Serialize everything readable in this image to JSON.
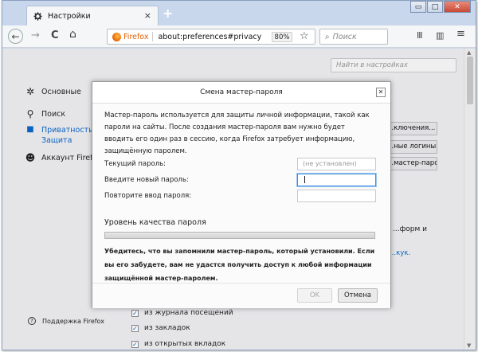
{
  "browser": {
    "tab_title": "Настройки",
    "tab_close": "×",
    "new_tab": "+",
    "window_controls": {
      "minimize": "▭",
      "maximize": "□",
      "close": "✕"
    },
    "back": "←",
    "forward": "→",
    "reload": "C",
    "home": "⌂",
    "identity_label": "Firefox",
    "url": "about:preferences#privacy",
    "zoom": "80%",
    "bookmark_star": "☆",
    "search_placeholder": "Поиск",
    "search_glyph": "⌕",
    "library": "Ⅲ",
    "sidebar": "▥",
    "menu": "≡"
  },
  "preferences": {
    "find_placeholder": "Найти в настройках",
    "sidebar": [
      {
        "label": "Основные",
        "icon": "gear-icon"
      },
      {
        "label": "Поиск",
        "icon": "search-icon"
      },
      {
        "label": "Приватность и",
        "label2": "Защита",
        "icon": "lock-icon"
      },
      {
        "label": "Аккаунт Firefox",
        "icon": "account-icon"
      }
    ],
    "support": "Поддержка Firefox",
    "bg_buttons": [
      "...ключения...",
      "...ные логины...",
      "...мастер-паро..."
    ],
    "bg_text_1": "...форм и",
    "bg_link": "...кук.",
    "checkbox_rows": [
      {
        "label": "из журнала посещений",
        "checked": "✓"
      },
      {
        "label": "из закладок",
        "checked": "✓"
      },
      {
        "label": "из открытых вкладок",
        "checked": "✓"
      }
    ]
  },
  "dialog": {
    "title": "Смена мастер-пароля",
    "close": "✕",
    "intro": "Мастер-пароль используется для защиты личной информации, такой как пароли на сайты. После создания мастер-пароля вам нужно будет вводить его один раз в сессию, когда Firefox затребует информацию, защищённую паролем.",
    "current_label": "Текущий пароль:",
    "current_value": "(не установлен)",
    "new_label": "Введите новый пароль:",
    "repeat_label": "Повторите ввод пароля:",
    "quality_title": "Уровень качества пароля",
    "quality_level": 0,
    "warning": "Убедитесь, что вы запомнили мастер-пароль, который установили. Если вы его забудете, вам не удастся получить доступ к любой информации защищённой мастер-паролем.",
    "ok": "OK",
    "cancel": "Отмена"
  },
  "colors": {
    "accent": "#0a64c8",
    "firefox_orange": "#e66000",
    "focus": "#3d8ede"
  }
}
